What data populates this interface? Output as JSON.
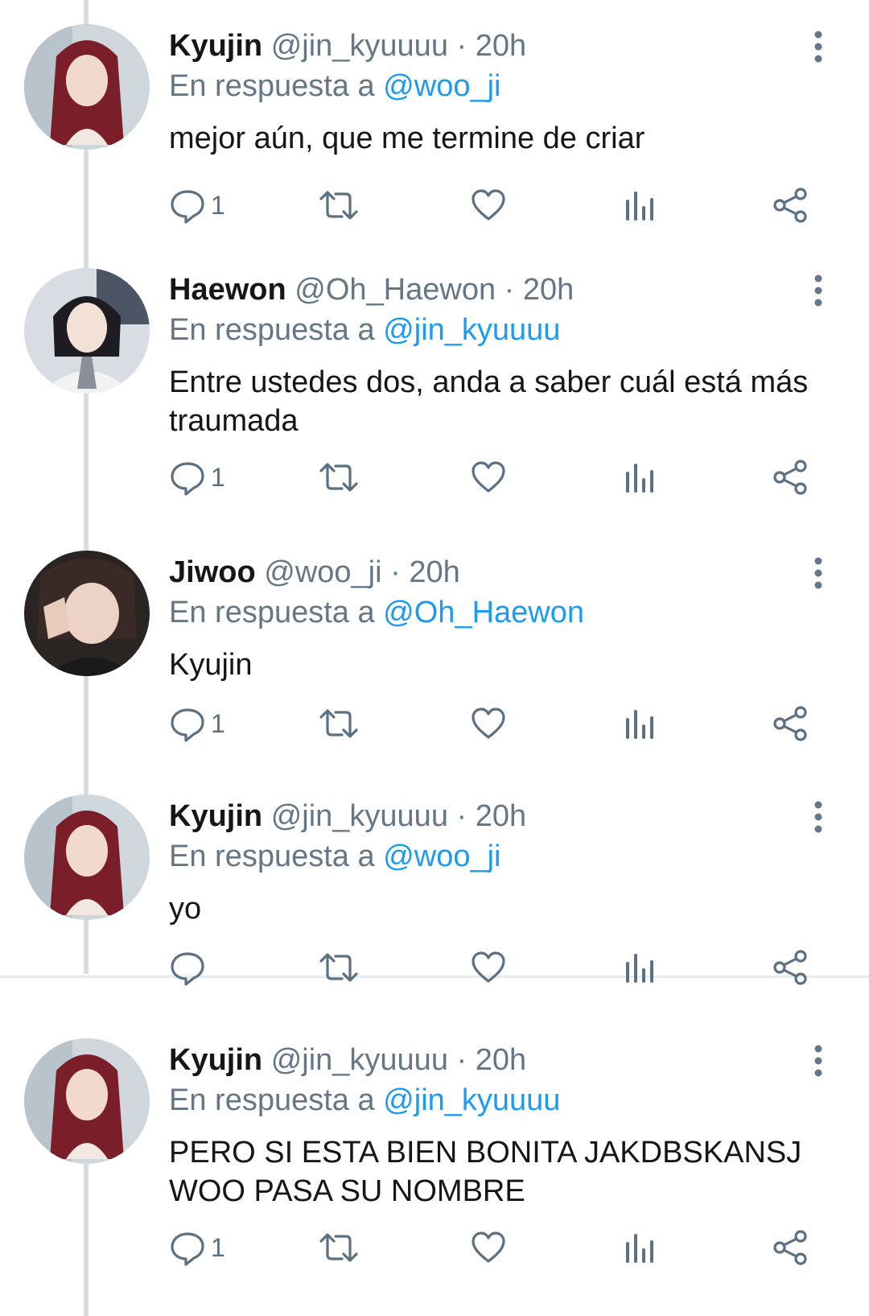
{
  "tweets": [
    {
      "name": "Kyujin",
      "handle": "@jin_kyuuuu",
      "time": "· 20h",
      "reply_prefix": "En respuesta a",
      "reply_to": "@woo_ji",
      "text": "mejor aún, que me termine de criar",
      "reply_count": "1"
    },
    {
      "name": "Haewon",
      "handle": "@Oh_Haewon",
      "time": "· 20h",
      "reply_prefix": "En respuesta a",
      "reply_to": "@jin_kyuuuu",
      "text": "Entre ustedes dos, anda a saber cuál está más traumada",
      "reply_count": "1"
    },
    {
      "name": "Jiwoo",
      "handle": "@woo_ji",
      "time": "· 20h",
      "reply_prefix": "En respuesta a",
      "reply_to": "@Oh_Haewon",
      "text": "Kyujin",
      "reply_count": "1"
    },
    {
      "name": "Kyujin",
      "handle": "@jin_kyuuuu",
      "time": "· 20h",
      "reply_prefix": "En respuesta a",
      "reply_to": "@woo_ji",
      "text": "yo",
      "reply_count": ""
    },
    {
      "name": "Kyujin",
      "handle": "@jin_kyuuuu",
      "time": "· 20h",
      "reply_prefix": "En respuesta a",
      "reply_to": "@jin_kyuuuu",
      "text": "PERO SI ESTA BIEN BONITA JAKDBSKANSJ WOO PASA SU NOMBRE",
      "reply_count": "1"
    }
  ],
  "colors": {
    "link": "#1d9bf0",
    "secondary_text": "#657786",
    "icon": "#5b7083",
    "thread_line": "#d9dde1"
  },
  "icons": [
    "reply-icon",
    "retweet-icon",
    "like-icon",
    "stats-icon",
    "share-icon",
    "more-options-icon"
  ]
}
